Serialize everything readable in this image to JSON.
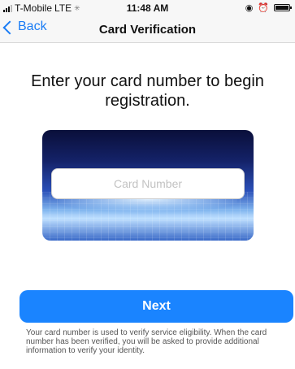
{
  "status_bar": {
    "carrier": "T-Mobile",
    "network": "LTE",
    "time": "11:48 AM"
  },
  "nav": {
    "back_label": "Back",
    "title": "Card Verification"
  },
  "main": {
    "heading": "Enter your card number to begin registration.",
    "card_input": {
      "placeholder": "Card Number",
      "value": ""
    },
    "next_label": "Next",
    "footer": "Your card number is used to verify service eligibility. When the card number has been verified, you will be asked to provide additional information to verify your identity."
  },
  "colors": {
    "accent": "#1a84ff",
    "link": "#1a7cf5"
  },
  "icons": [
    "signal-icon",
    "lte-icon",
    "location-icon",
    "alarm-icon",
    "battery-icon",
    "chevron-left-icon"
  ]
}
